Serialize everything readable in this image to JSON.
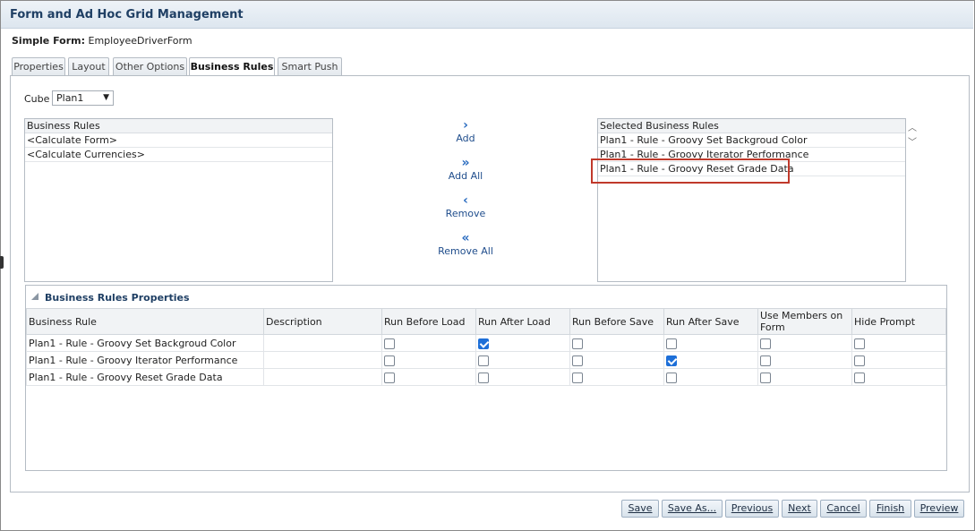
{
  "window": {
    "title": "Form and Ad Hoc Grid Management"
  },
  "form": {
    "label": "Simple Form:",
    "name": "EmployeeDriverForm"
  },
  "tabs": [
    {
      "label": "Properties"
    },
    {
      "label": "Layout"
    },
    {
      "label": "Other Options"
    },
    {
      "label": "Business Rules",
      "active": true
    },
    {
      "label": "Smart Push"
    }
  ],
  "cube": {
    "label": "Cube",
    "value": "Plan1"
  },
  "available_rules": {
    "header": "Business Rules",
    "items": [
      "<Calculate Form>",
      "<Calculate Currencies>"
    ]
  },
  "move_buttons": {
    "add": "Add",
    "add_all": "Add All",
    "remove": "Remove",
    "remove_all": "Remove All"
  },
  "selected_rules": {
    "header": "Selected Business Rules",
    "items": [
      "Plan1 - Rule - Groovy Set Backgroud Color",
      "Plan1 - Rule - Groovy Iterator Performance",
      "Plan1 - Rule - Groovy Reset Grade Data"
    ]
  },
  "properties": {
    "title": "Business Rules Properties",
    "columns": [
      "Business Rule",
      "Description",
      "Run Before Load",
      "Run After Load",
      "Run Before Save",
      "Run After Save",
      "Use Members on Form",
      "Hide Prompt"
    ],
    "rows": [
      {
        "rule": "Plan1 - Rule - Groovy Set Backgroud Color",
        "description": "",
        "checks": [
          false,
          true,
          false,
          false,
          false,
          false
        ]
      },
      {
        "rule": "Plan1 - Rule - Groovy Iterator Performance",
        "description": "",
        "checks": [
          false,
          false,
          false,
          true,
          false,
          false
        ]
      },
      {
        "rule": "Plan1 - Rule - Groovy Reset Grade Data",
        "description": "",
        "checks": [
          false,
          false,
          false,
          false,
          false,
          false
        ]
      }
    ]
  },
  "footer_buttons": [
    "Save",
    "Save As...",
    "Previous",
    "Next",
    "Cancel",
    "Finish",
    "Preview"
  ],
  "colors": {
    "highlight": "#c0392b",
    "accent": "#1d6fd8",
    "title": "#1f3f64"
  }
}
